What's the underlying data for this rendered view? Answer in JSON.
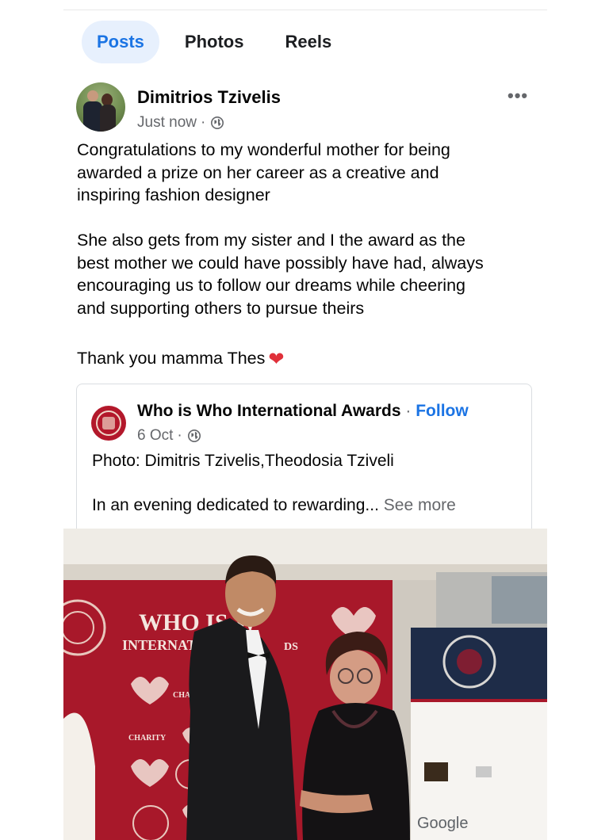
{
  "tabs": [
    {
      "label": "Posts",
      "active": true
    },
    {
      "label": "Photos",
      "active": false
    },
    {
      "label": "Reels",
      "active": false
    }
  ],
  "post": {
    "author": "Dimitrios Tzivelis",
    "time": "Just now",
    "separator": "·",
    "privacy_icon": "globe-icon",
    "more_icon": "•••",
    "paragraphs": [
      "Congratulations to my wonderful mother for being\nawarded a prize on her career as a creative and\ninspiring fashion designer",
      "She also gets from my sister and I the award as the\nbest mother we could have possibly have had, always\nencouraging us to follow our dreams while cheering\nand supporting others to pursue theirs",
      "Thank you mamma Thes"
    ],
    "emoji": "❤"
  },
  "shared": {
    "page_name": "Who is Who International Awards",
    "separator": "·",
    "follow_label": "Follow",
    "date": "6 Oct",
    "line1": "Photo: Dimitris Tzivelis,Theodosia Tziveli",
    "line2": "In an evening dedicated to rewarding...",
    "see_more": "See more"
  },
  "photo": {
    "banner_line1": "WHO IS W",
    "banner_line2": "INTERNATIO",
    "banner_ds": "DS",
    "banner_charity": "CHARITY",
    "banner_cha": "CHA",
    "sponsor_google": "Google"
  },
  "colors": {
    "accent": "#1b74e4",
    "tab_active_bg": "#e7f0fd",
    "heart": "#e0303a",
    "banner_red": "#a8182a"
  }
}
